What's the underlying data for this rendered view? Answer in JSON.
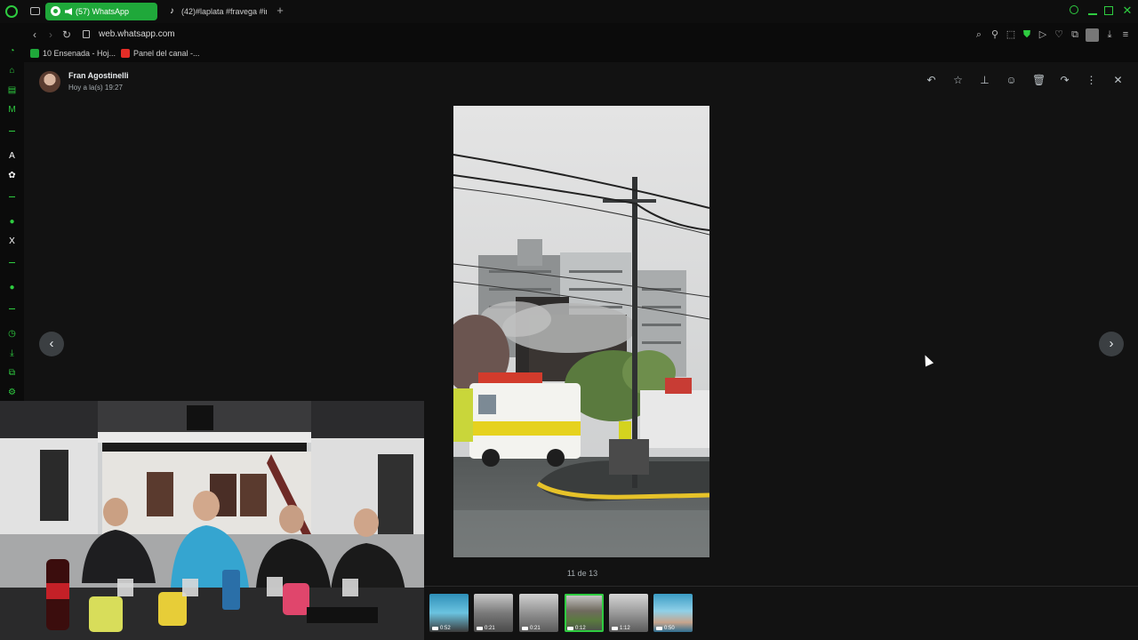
{
  "browser": {
    "tabs": [
      {
        "label": "(57) WhatsApp",
        "active": true
      },
      {
        "label": "(42)#laplata #fravega #in",
        "active": false
      }
    ],
    "address": {
      "url": "web.whatsapp.com"
    },
    "bookmarks": [
      {
        "label": "10 Ensenada - Hoj..."
      },
      {
        "label": "Panel del canal -..."
      }
    ]
  },
  "viewer": {
    "sender_name": "Fran Agostinelli",
    "timestamp": "Hoy a la(s) 19:27",
    "counter": "11 de 13",
    "thumbnails": [
      {
        "duration": "0:52"
      },
      {
        "duration": "0:21"
      },
      {
        "duration": "0:21"
      },
      {
        "duration": "0:12"
      },
      {
        "duration": "1:12"
      },
      {
        "duration": "0:50"
      }
    ]
  },
  "colors": {
    "accent": "#2ecc40",
    "tab_active": "#1fa83a",
    "viewer_bg": "#121212"
  },
  "icons": {
    "toolbar": [
      "reply-icon",
      "star-icon",
      "pin-icon",
      "emoji-icon",
      "delete-icon",
      "forward-icon",
      "menu-dots-icon",
      "close-icon"
    ]
  }
}
